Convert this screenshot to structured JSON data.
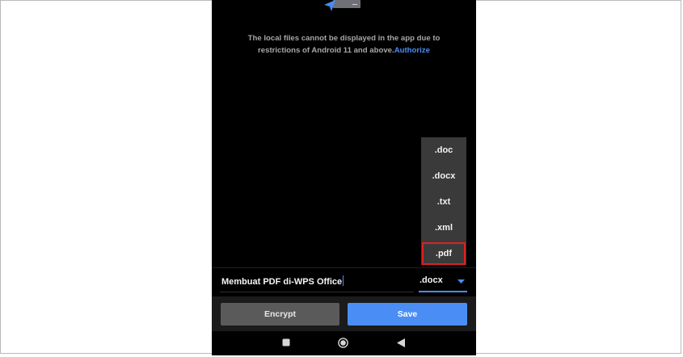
{
  "notice": {
    "text": "The local files cannot be displayed in the app due to restrictions of Android 11 and above.",
    "link": "Authorize"
  },
  "format_menu": {
    "options": [
      ".doc",
      ".docx",
      ".txt",
      ".xml",
      ".pdf"
    ],
    "highlighted": ".pdf"
  },
  "file": {
    "name": "Membuat PDF di-WPS Office",
    "extension": ".docx"
  },
  "actions": {
    "encrypt": "Encrypt",
    "save": "Save"
  },
  "colors": {
    "accent": "#4a8ef5",
    "highlight": "#e02020"
  },
  "nav_icons": [
    "recents-square-icon",
    "home-circle-icon",
    "back-triangle-icon"
  ]
}
